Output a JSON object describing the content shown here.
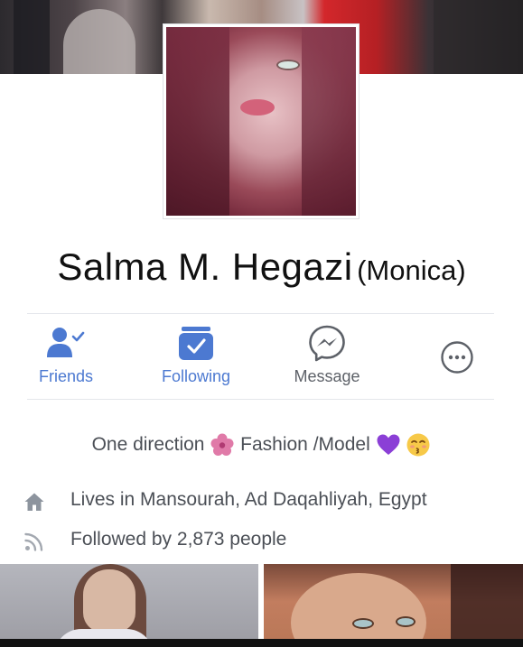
{
  "profile": {
    "name": "Salma M. Hegazi",
    "nickname": "(Monica)"
  },
  "actions": {
    "friends": {
      "label": "Friends",
      "icon": "friends-check-icon"
    },
    "following": {
      "label": "Following",
      "icon": "following-check-icon"
    },
    "message": {
      "label": "Message",
      "icon": "messenger-icon"
    },
    "more": {
      "icon": "more-icon"
    }
  },
  "bio": {
    "part1": "One direction",
    "part2": "Fashion /Model"
  },
  "info": {
    "lives": "Lives in Mansourah, Ad Daqahliyah, Egypt",
    "followers": "Followed by 2,873 people"
  },
  "colors": {
    "accent": "#4c79d1",
    "text_gray": "#4b4f56"
  }
}
